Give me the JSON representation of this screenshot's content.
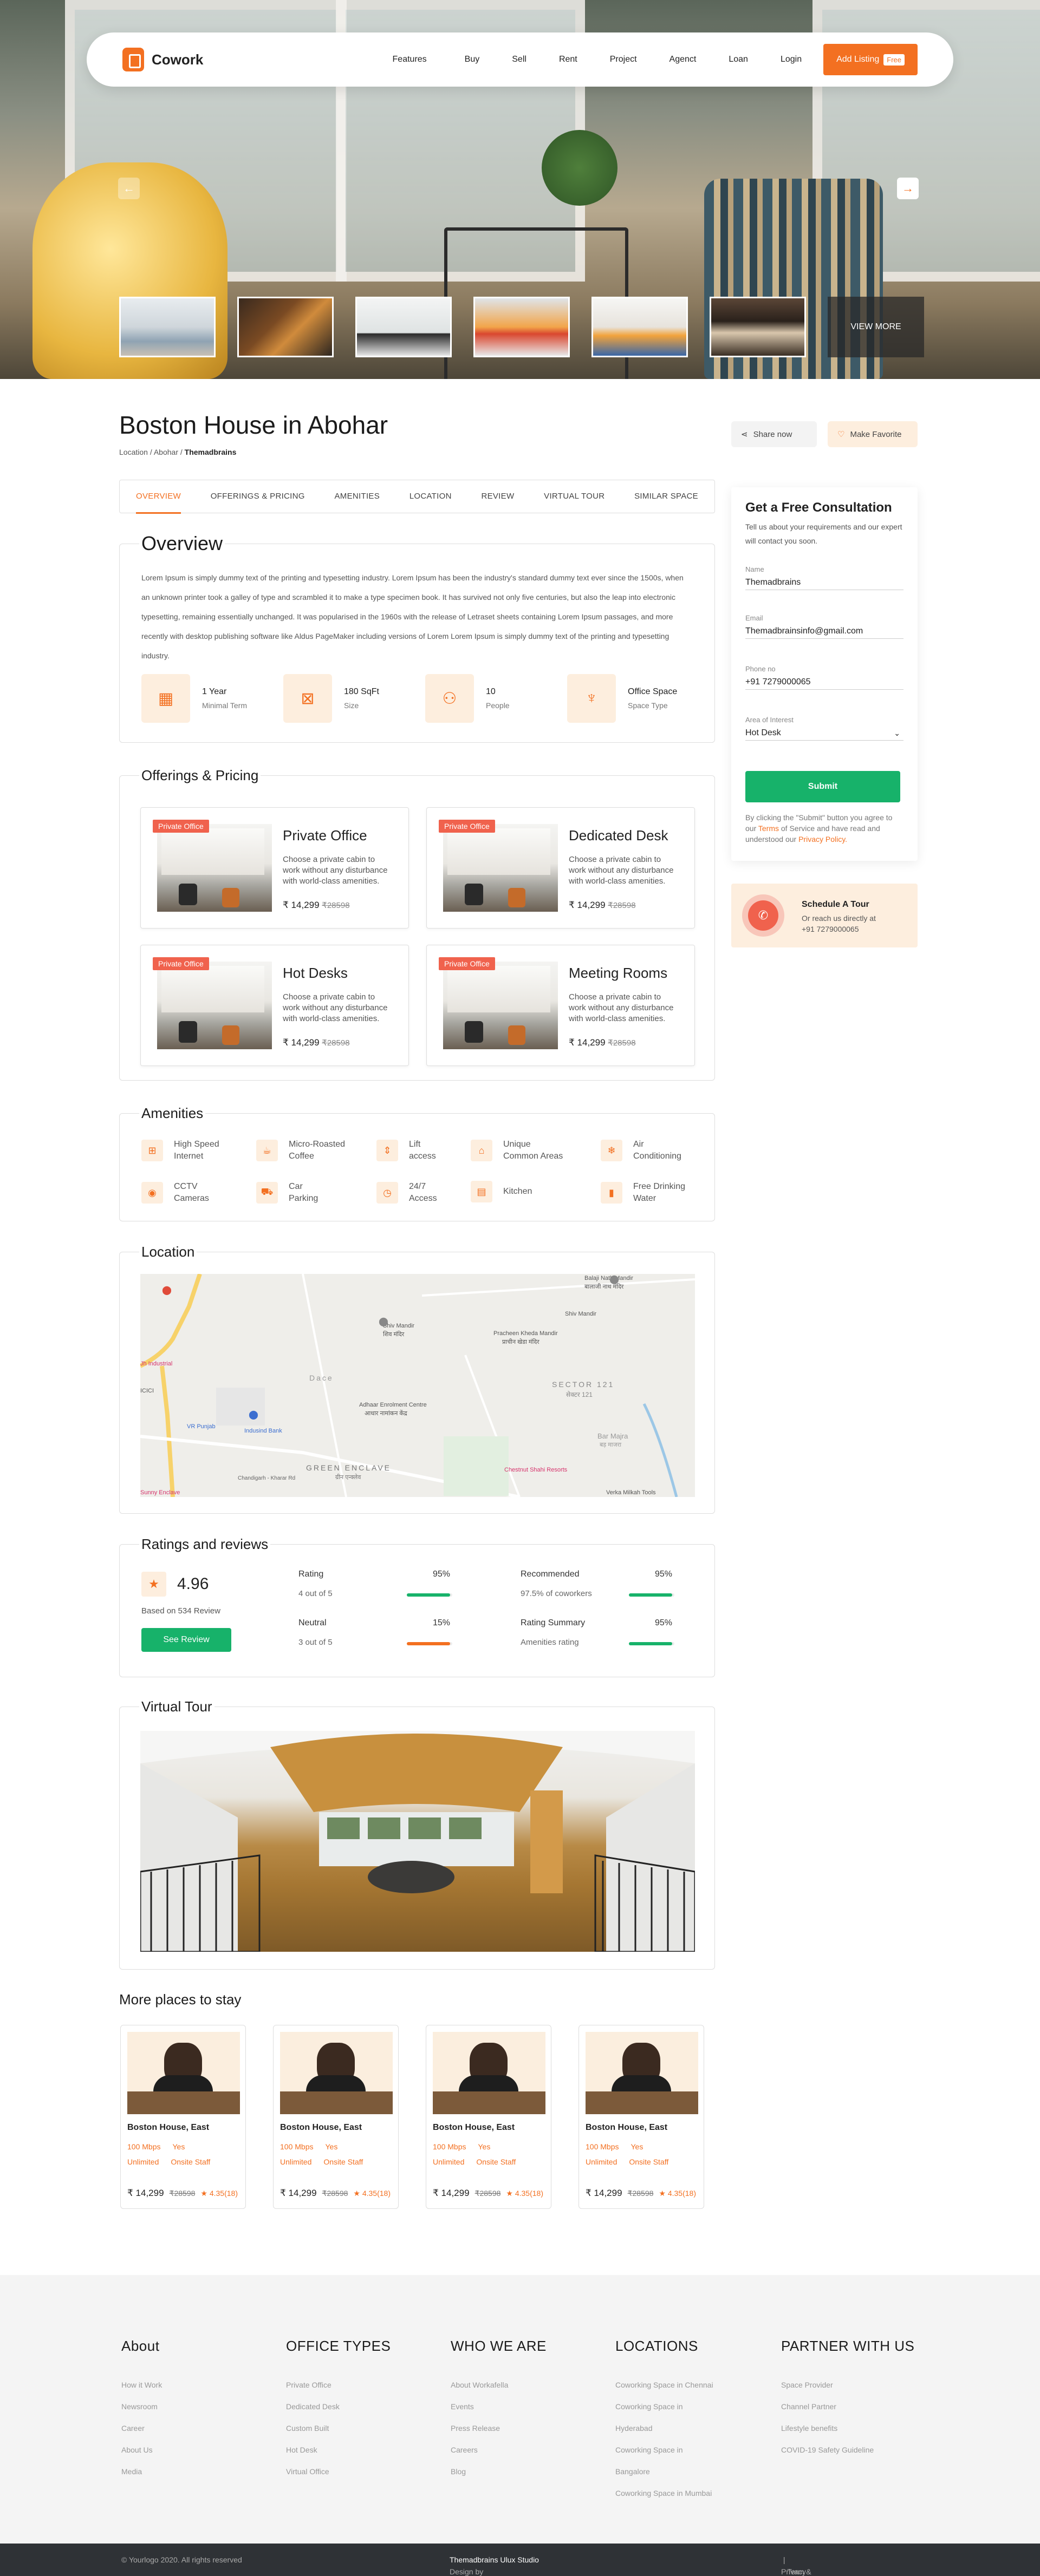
{
  "brand": {
    "name": "Cowork",
    "accent": "#f37021",
    "green": "#17b26a",
    "badge_red": "#f0624d"
  },
  "nav": {
    "items": [
      "Features",
      "Buy",
      "Sell",
      "Rent",
      "Project",
      "Agenct",
      "Loan",
      "Login"
    ],
    "cta": "Add Listing",
    "cta_badge": "Free"
  },
  "gallery": {
    "more_label": "VIEW MORE"
  },
  "page": {
    "title": "Boston House in Abohar",
    "crumb_a": "Location",
    "crumb_b": "Abohar",
    "crumb_c": "Themadbrains",
    "share": "Share now",
    "favorite": "Make Favorite"
  },
  "tabs": [
    "OVERVIEW",
    "OFFERINGS & PRICING",
    "AMENITIES",
    "LOCATION",
    "REVIEW",
    "VIRTUAL TOUR",
    "SIMILAR SPACE"
  ],
  "overview": {
    "title": "Overview",
    "text": "Lorem Ipsum is simply dummy text of the printing and typesetting industry. Lorem Ipsum has been the industry's standard dummy text ever since the 1500s, when an unknown printer took a galley of type and scrambled it to make a type specimen book. It has survived not only five centuries, but also the leap into electronic typesetting, remaining essentially unchanged. It was popularised in the 1960s with the release of Letraset sheets containing Lorem Ipsum passages, and more recently with desktop publishing software like Aldus PageMaker including versions of Lorem Lorem Ipsum is simply dummy text of the printing and typesetting industry.",
    "stats": [
      {
        "value": "1 Year",
        "label": "Minimal Term",
        "icon": "calendar-icon"
      },
      {
        "value": "180 SqFt",
        "label": "Size",
        "icon": "area-icon"
      },
      {
        "value": "10",
        "label": "People",
        "icon": "people-icon"
      },
      {
        "value": "Office Space",
        "label": "Space Type",
        "icon": "mic-icon"
      }
    ]
  },
  "offerings": {
    "title": "Offerings & Pricing",
    "items": [
      {
        "tag": "Private Office",
        "name": "Private Office",
        "desc": "Choose a private cabin to work without any disturbance with world-class amenities.",
        "price": "₹ 14,299",
        "old": "₹28598"
      },
      {
        "tag": "Private Office",
        "name": "Dedicated Desk",
        "desc": "Choose a private cabin to work without any disturbance with world-class amenities.",
        "price": "₹ 14,299",
        "old": "₹28598"
      },
      {
        "tag": "Private Office",
        "name": "Hot Desks",
        "desc": "Choose a private cabin to work without any disturbance with world-class amenities.",
        "price": "₹ 14,299",
        "old": "₹28598"
      },
      {
        "tag": "Private Office",
        "name": "Meeting Rooms",
        "desc": "Choose a private cabin to work without any disturbance with world-class amenities.",
        "price": "₹ 14,299",
        "old": "₹28598"
      }
    ]
  },
  "amenities": {
    "title": "Amenities",
    "items": [
      {
        "l1": "High Speed",
        "l2": "Internet",
        "icon": "wifi-icon"
      },
      {
        "l1": "Micro-Roasted",
        "l2": "Coffee",
        "icon": "coffee-icon"
      },
      {
        "l1": "Lift",
        "l2": "access",
        "icon": "lift-icon"
      },
      {
        "l1": "Unique",
        "l2": "Common Areas",
        "icon": "sofa-icon"
      },
      {
        "l1": "Air",
        "l2": "Conditioning",
        "icon": "ac-icon"
      },
      {
        "l1": "CCTV",
        "l2": "Cameras",
        "icon": "cctv-icon"
      },
      {
        "l1": "Car",
        "l2": "Parking",
        "icon": "car-icon"
      },
      {
        "l1": "24/7",
        "l2": "Access",
        "icon": "clock-icon"
      },
      {
        "l1": "Kitchen",
        "l2": "",
        "icon": "kitchen-icon"
      },
      {
        "l1": "Free Drinking",
        "l2": "Water",
        "icon": "water-icon"
      }
    ]
  },
  "location": {
    "title": "Location",
    "labels": [
      "Balaji Nath Mandir",
      "बालाजी नाथ मंदिर",
      "Shiv Mandir",
      "शिव मंदिर",
      "Shiv Mandir",
      "Pracheen Kheda Mandir",
      "प्राचीन खेडा मंदिर",
      "Dace",
      "SECTOR 121",
      "सेक्टर 121",
      "Adhaar Enrolment Centre",
      "आधार नामांकन केंद्र",
      "VR Punjab",
      "Indusind Bank",
      "GREEN ENCLAVE",
      "ग्रीन एन्क्लेव",
      "Bar Majra",
      "बड़ माजरा",
      "Chandigarh - Kharar Rd",
      "Chestnut Shahi Resorts",
      "Verka Milkah Tools",
      "Sunny Enclave",
      "Jh Industrial",
      "ICICI"
    ]
  },
  "ratings": {
    "title": "Ratings and reviews",
    "score": "4.96",
    "based": "Based on 534 Review",
    "button": "See Review",
    "rows": [
      {
        "k": "Rating",
        "pct": "95%",
        "s": "4 out of 5",
        "fill": 0.95,
        "color": "#17b26a"
      },
      {
        "k": "Recommended",
        "pct": "95%",
        "s": "97.5% of coworkers",
        "fill": 0.95,
        "color": "#17b26a"
      },
      {
        "k": "Neutral",
        "pct": "15%",
        "s": "3 out of 5",
        "fill": 0.95,
        "color": "#f37021"
      },
      {
        "k": "Rating Summary",
        "pct": "95%",
        "s": "Amenities rating",
        "fill": 0.95,
        "color": "#17b26a"
      }
    ]
  },
  "tour": {
    "title": "Virtual Tour"
  },
  "places": {
    "title": "More places to stay",
    "items": [
      {
        "name": "Boston House, East",
        "a1": "100 Mbps",
        "a2": "Yes",
        "a3": "Unlimited",
        "a4": "Onsite Staff",
        "price": "₹ 14,299",
        "old": "₹28598",
        "rating": "4.35(18)"
      },
      {
        "name": "Boston House, East",
        "a1": "100 Mbps",
        "a2": "Yes",
        "a3": "Unlimited",
        "a4": "Onsite Staff",
        "price": "₹ 14,299",
        "old": "₹28598",
        "rating": "4.35(18)"
      },
      {
        "name": "Boston House, East",
        "a1": "100 Mbps",
        "a2": "Yes",
        "a3": "Unlimited",
        "a4": "Onsite Staff",
        "price": "₹ 14,299",
        "old": "₹28598",
        "rating": "4.35(18)"
      },
      {
        "name": "Boston House, East",
        "a1": "100 Mbps",
        "a2": "Yes",
        "a3": "Unlimited",
        "a4": "Onsite Staff",
        "price": "₹ 14,299",
        "old": "₹28598",
        "rating": "4.35(18)"
      }
    ]
  },
  "form": {
    "title": "Get a Free Consultation",
    "desc": "Tell us about your requirements and our expert will contact you soon.",
    "name_label": "Name",
    "name_value": "Themadbrains",
    "email_label": "Email",
    "email_value": "Themadbrainsinfo@gmail.com",
    "phone_label": "Phone no",
    "phone_value": "+91 7279000065",
    "area_label": "Area of Interest",
    "area_value": "Hot Desk",
    "submit": "Submit",
    "note_a": "By clicking the \"Submit\" button you agree to our",
    "note_terms": "Terms",
    "note_b": "of Service and have read and understood our",
    "note_privacy": "Privacy Policy."
  },
  "schedule": {
    "title": "Schedule A Tour",
    "line1": "Or reach us directly at",
    "line2": "+91 7279000065"
  },
  "footer": {
    "cols": [
      {
        "title": "About",
        "links": [
          "How it Work",
          "Newsroom",
          "Career",
          "About Us",
          "Media"
        ]
      },
      {
        "title": "OFFICE TYPES",
        "links": [
          "Private Office",
          "Dedicated Desk",
          "Custom Built",
          "Hot Desk",
          "Virtual Office"
        ]
      },
      {
        "title": "WHO WE ARE",
        "links": [
          "About Workafella",
          "Events",
          "Press Release",
          "Careers",
          "Blog"
        ]
      },
      {
        "title": "LOCATIONS",
        "links": [
          "Coworking Space in Chennai",
          "Coworking Space in",
          "Hyderabad",
          "Coworking Space in",
          "Bangalore",
          "Coworking Space in Mumbai"
        ]
      },
      {
        "title": "PARTNER WITH US",
        "links": [
          "Space Provider",
          "Channel Partner",
          "Lifestyle benefits",
          "COVID-19 Safety Guideline"
        ]
      }
    ],
    "copyright": "© Yourlogo 2020. All rights reserved",
    "design_by": "Design by",
    "studio": "Themadbrains Ulux Studio",
    "privacy": "Privacy Policy",
    "terms": "Term & Condination"
  }
}
